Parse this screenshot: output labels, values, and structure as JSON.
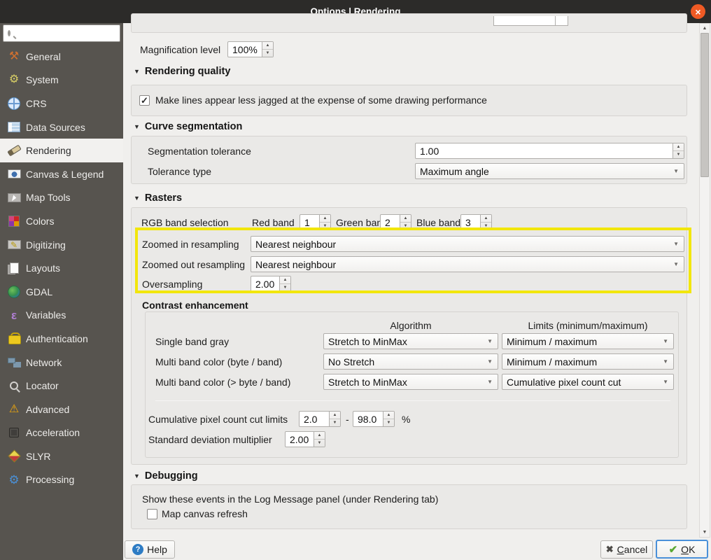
{
  "window": {
    "title": "Options | Rendering"
  },
  "icons": {
    "close": "×",
    "section_arrow": "▼",
    "spin_up": "▲",
    "spin_down": "▼",
    "combo_arrow": "▼",
    "check": "✓",
    "scroll_up": "▲",
    "scroll_down": "▼",
    "general": "⚒",
    "system": "⚙",
    "variables": "ε",
    "pencil": "✎",
    "advanced": "⚠",
    "processing": "⚙",
    "help": "?",
    "cancel": "✖",
    "ok": "✔"
  },
  "sidebar": {
    "search_value": "",
    "items": [
      {
        "label": "General"
      },
      {
        "label": "System"
      },
      {
        "label": "CRS"
      },
      {
        "label": "Data Sources"
      },
      {
        "label": "Rendering"
      },
      {
        "label": "Canvas & Legend"
      },
      {
        "label": "Map Tools"
      },
      {
        "label": "Colors"
      },
      {
        "label": "Digitizing"
      },
      {
        "label": "Layouts"
      },
      {
        "label": "GDAL"
      },
      {
        "label": "Variables"
      },
      {
        "label": "Authentication"
      },
      {
        "label": "Network"
      },
      {
        "label": "Locator"
      },
      {
        "label": "Advanced"
      },
      {
        "label": "Acceleration"
      },
      {
        "label": "SLYR"
      },
      {
        "label": "Processing"
      }
    ]
  },
  "content": {
    "magnification": {
      "label": "Magnification level",
      "value": "100%"
    },
    "rendering_quality": {
      "title": "Rendering quality",
      "antialias_label": "Make lines appear less jagged at the expense of some drawing performance",
      "antialias_checked": true
    },
    "curve_segmentation": {
      "title": "Curve segmentation",
      "tolerance_label": "Segmentation tolerance",
      "tolerance_value": "1.00",
      "type_label": "Tolerance type",
      "type_value": "Maximum angle"
    },
    "rasters": {
      "title": "Rasters",
      "rgb_label": "RGB band selection",
      "red_label": "Red band",
      "red_value": "1",
      "green_label": "Green band",
      "green_value": "2",
      "blue_label": "Blue band",
      "blue_value": "3",
      "zoomed_in_label": "Zoomed in resampling",
      "zoomed_in_value": "Nearest neighbour",
      "zoomed_out_label": "Zoomed out resampling",
      "zoomed_out_value": "Nearest neighbour",
      "oversampling_label": "Oversampling",
      "oversampling_value": "2.00"
    },
    "contrast": {
      "title": "Contrast enhancement",
      "col_algorithm": "Algorithm",
      "col_limits": "Limits (minimum/maximum)",
      "rows": [
        {
          "label": "Single band gray",
          "algorithm": "Stretch to MinMax",
          "limits": "Minimum / maximum"
        },
        {
          "label": "Multi band color (byte / band)",
          "algorithm": "No Stretch",
          "limits": "Minimum / maximum"
        },
        {
          "label": "Multi band color (> byte / band)",
          "algorithm": "Stretch to MinMax",
          "limits": "Cumulative pixel count cut"
        }
      ],
      "cut_limits_label": "Cumulative pixel count cut limits",
      "cut_min": "2.0",
      "cut_sep": "-",
      "cut_max": "98.0",
      "cut_unit": "%",
      "stddev_label": "Standard deviation multiplier",
      "stddev_value": "2.00"
    },
    "debugging": {
      "title": "Debugging",
      "info_label": "Show these events in the Log Message panel (under Rendering tab)",
      "checkbox_label": "Map canvas refresh",
      "checkbox_checked": false
    }
  },
  "footer": {
    "help_label": "Help",
    "cancel_label": "Cancel",
    "ok_label": "OK"
  },
  "colors": {
    "highlight_yellow": "#f2e60c",
    "titlebar": "#2c2b29",
    "close_button": "#ef5a24",
    "sidebar": "#57544f",
    "selected_item": "#f2f1ef",
    "focus_ring": "#4a90d9"
  }
}
